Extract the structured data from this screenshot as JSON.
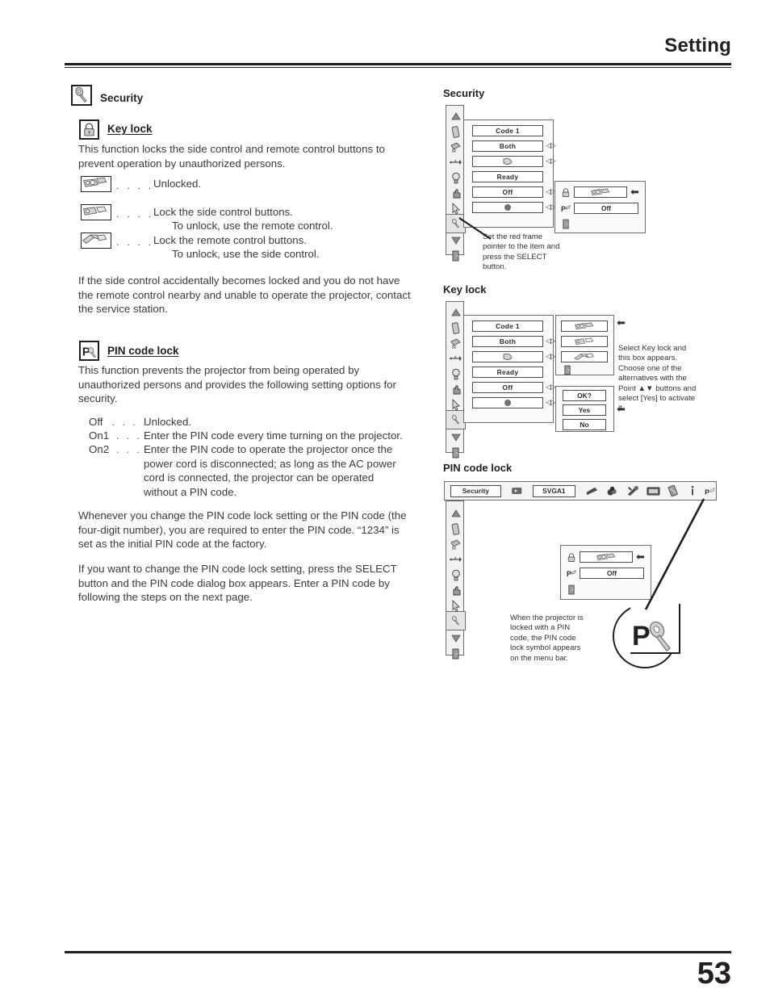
{
  "header": {
    "title": "Setting"
  },
  "footer": {
    "page_number": "53"
  },
  "left_column": {
    "security_heading": "Security",
    "keylock_heading": "Key lock",
    "keylock_desc": "This function locks the side control and remote control buttons to prevent operation by unauthorized persons.",
    "keylock_options": [
      {
        "icon": "remote-unlocked-icon",
        "leader": ". . . .",
        "lines": [
          "Unlocked."
        ]
      },
      {
        "icon": "side-control-lock-icon",
        "leader": ". . . .",
        "lines": [
          "Lock the side control buttons.",
          "To unlock, use the remote control."
        ]
      },
      {
        "icon": "remote-control-lock-icon",
        "leader": ". . . .",
        "lines": [
          "Lock the remote control buttons.",
          "To unlock, use the side control."
        ]
      }
    ],
    "keylock_note": "If the side control accidentally becomes locked and you do not have the remote control nearby and unable to operate the projector, contact the service station.",
    "pincode_heading": "PIN code lock",
    "pincode_desc": "This function prevents the projector from being operated by unauthorized persons and provides the following setting options for security.",
    "pincode_options": [
      {
        "label": "Off",
        "leader": ". . . .",
        "text": "Unlocked."
      },
      {
        "label": "On1",
        "leader": ". . .",
        "text": "Enter the PIN code every time turning on the projector."
      },
      {
        "label": "On2",
        "leader": ". . .",
        "text": "Enter the PIN code to operate the projector once the power cord is disconnected; as long as the AC power cord is connected, the projector can be operated without a PIN code."
      }
    ],
    "pincode_note1": "Whenever you change the PIN code lock setting or the PIN code (the four-digit number), you are required to enter the PIN code. “1234” is set as the initial PIN code at the factory.",
    "pincode_note2": "If you want to change the PIN code lock setting, press the SELECT button and the PIN code dialog box appears. Enter a PIN code by following the steps on the next page."
  },
  "right_column": {
    "fig_security": {
      "title": "Security",
      "sidebar_icons": [
        "up-arrow-icon",
        "remote-icon",
        "ir-remote-icon",
        "usb-icon",
        "lamp-icon",
        "hand-pointer-icon",
        "mouse-pointer-icon",
        "key-security-icon",
        "down-arrow-icon",
        "exit-icon"
      ],
      "selected_sidebar_index": 7,
      "rows": [
        {
          "label": "Code 1",
          "arrows": false
        },
        {
          "label": "Both",
          "arrows": true
        },
        {
          "label": "",
          "icon": "pointer-icon",
          "arrows": true
        },
        {
          "label": "Ready",
          "arrows": false
        },
        {
          "label": "Off",
          "arrows": true
        },
        {
          "label": "",
          "icon": "dot-icon",
          "arrows": true
        }
      ],
      "popup": {
        "rows": [
          {
            "icon": "padlock-icon",
            "value": "",
            "value_icon": "remote-unlocked-icon",
            "arrow": true
          },
          {
            "icon": "pin-key-icon",
            "value": "Off",
            "arrow": false
          },
          {
            "icon": "exit-icon",
            "value": null,
            "arrow": false
          }
        ]
      },
      "caption": "Set the red frame pointer to the item and press the SELECT button."
    },
    "fig_keylock": {
      "title": "Key lock",
      "rows": [
        {
          "label": "Code 1",
          "arrows": false
        },
        {
          "label": "Both",
          "arrows": true
        },
        {
          "label": "",
          "icon": "pointer-icon",
          "arrows": true
        },
        {
          "label": "Ready",
          "arrows": false
        },
        {
          "label": "Off",
          "arrows": true
        },
        {
          "label": "",
          "icon": "dot-icon",
          "arrows": true
        }
      ],
      "choice_box": [
        {
          "icon": "remote-unlocked-icon",
          "arrow": true
        },
        {
          "icon": "side-control-lock-icon",
          "arrow": false
        },
        {
          "icon": "remote-control-lock-icon",
          "arrow": false
        },
        {
          "icon": "exit-icon",
          "arrow": false
        }
      ],
      "confirm_box": [
        {
          "label": "OK?",
          "arrow": false
        },
        {
          "label": "Yes",
          "arrow": true
        },
        {
          "label": "No",
          "arrow": false
        }
      ],
      "caption": "Select Key lock and this box appears. Choose one of the alternatives with the Point ▲▼ buttons and select [Yes] to activate it."
    },
    "fig_pincodelock": {
      "title": "PIN code lock",
      "menubar": {
        "selected_label": "Security",
        "source_icon": "projector-icon",
        "source_label": "SVGA1",
        "icons": [
          "image-adjust-icon",
          "color-icon",
          "settings-tools-icon",
          "screen-icon",
          "remote-icon",
          "info-icon",
          "pin-lock-icon"
        ]
      },
      "popup": {
        "rows": [
          {
            "icon": "padlock-icon",
            "value_icon": "remote-unlocked-icon",
            "arrow": true
          },
          {
            "icon": "pin-key-icon",
            "value": "Off",
            "arrow": false
          },
          {
            "icon": "exit-icon",
            "value": null,
            "arrow": false
          }
        ]
      },
      "caption": "When the projector is locked with a PIN code, the PIN code lock symbol appears on the menu bar.",
      "callout_icon": "pin-code-lock-symbol"
    }
  }
}
